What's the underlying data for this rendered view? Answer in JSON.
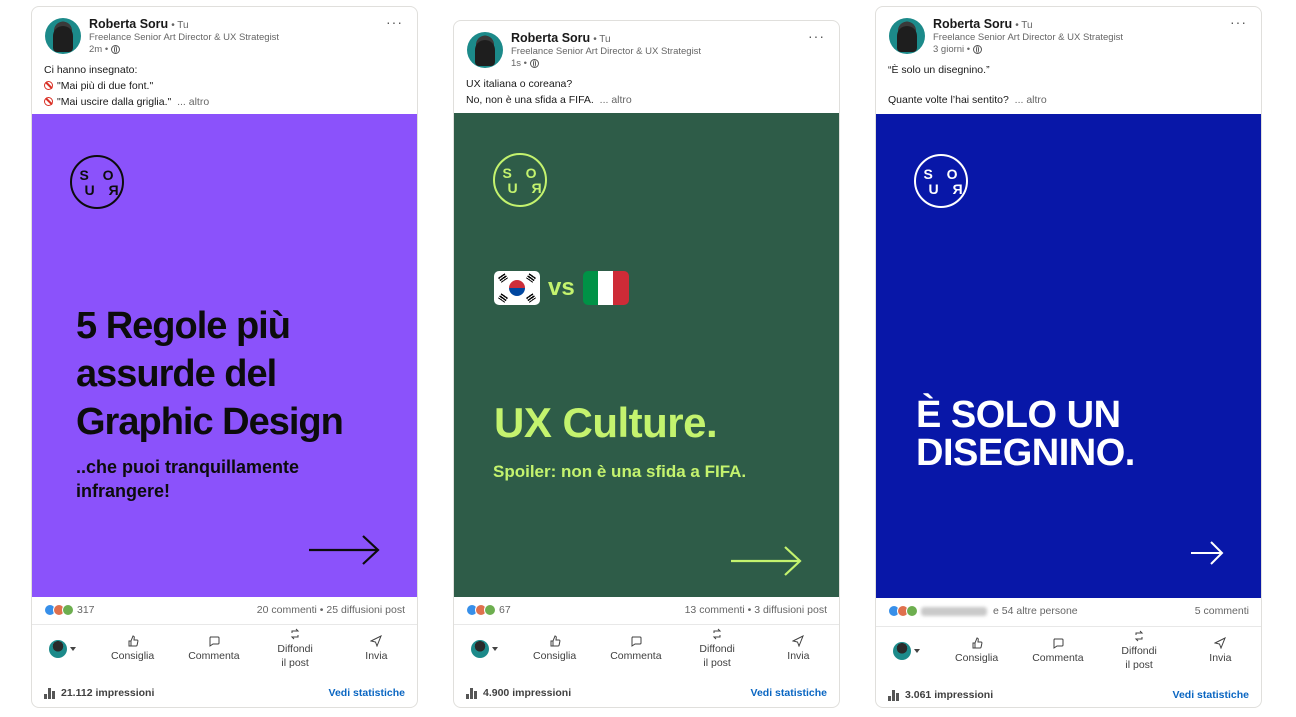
{
  "colors": {
    "post1_bg": "#8b52fb",
    "post2_bg": "#2e5c48",
    "post3_bg": "#0817a8",
    "lime": "#c4f36e",
    "link": "#0a66c2"
  },
  "posts": [
    {
      "author": "Roberta Soru",
      "you": "• Tu",
      "role": "Freelance Senior Art Director & UX Strategist",
      "time": "2m •",
      "text_lines": [
        "Ci hanno insegnato:",
        "\"Mai più di due font.\"",
        "\"Mai uscire dalla griglia.\""
      ],
      "more": "... altro",
      "logo_top": "S O",
      "logo_bottom": "R U",
      "headline": [
        "5 Regole più",
        "assurde del",
        "Graphic Design"
      ],
      "subline": [
        "..che puoi tranquillamente",
        "infrangere!"
      ],
      "reactions": "317",
      "comments": "20 commenti • 25 diffusioni post",
      "actions": {
        "like": "Consiglia",
        "comment": "Commenta",
        "share_1": "Diffondi",
        "share_2": "il post",
        "send": "Invia"
      },
      "impressions": "21.112 impressioni",
      "stats_link": "Vedi statistiche"
    },
    {
      "author": "Roberta Soru",
      "you": "• Tu",
      "role": "Freelance Senior Art Director & UX Strategist",
      "time": "1s •",
      "text_lines": [
        "UX italiana o coreana?",
        "No, non è una sfida a FIFA."
      ],
      "more": "... altro",
      "logo_top": "S O",
      "logo_bottom": "R U",
      "vs": "vs",
      "headline": [
        "UX Culture."
      ],
      "subline": [
        "Spoiler: non è una sfida a FIFA."
      ],
      "reactions": "67",
      "comments": "13 commenti • 3 diffusioni post",
      "actions": {
        "like": "Consiglia",
        "comment": "Commenta",
        "share_1": "Diffondi",
        "share_2": "il post",
        "send": "Invia"
      },
      "impressions": "4.900 impressioni",
      "stats_link": "Vedi statistiche"
    },
    {
      "author": "Roberta Soru",
      "you": "• Tu",
      "role": "Freelance Senior Art Director & UX Strategist",
      "time": "3 giorni •",
      "text_lines": [
        "“È solo un disegnino.”",
        "",
        "Quante volte l’hai sentito?"
      ],
      "more": "... altro",
      "logo_top": "S O",
      "logo_bottom": "R U",
      "headline": [
        "È SOLO UN",
        "DISEGNINO."
      ],
      "reactions": "e 54 altre persone",
      "comments": "5 commenti",
      "actions": {
        "like": "Consiglia",
        "comment": "Commenta",
        "share_1": "Diffondi",
        "share_2": "il post",
        "send": "Invia"
      },
      "impressions": "3.061 impressioni",
      "stats_link": "Vedi statistiche"
    }
  ]
}
